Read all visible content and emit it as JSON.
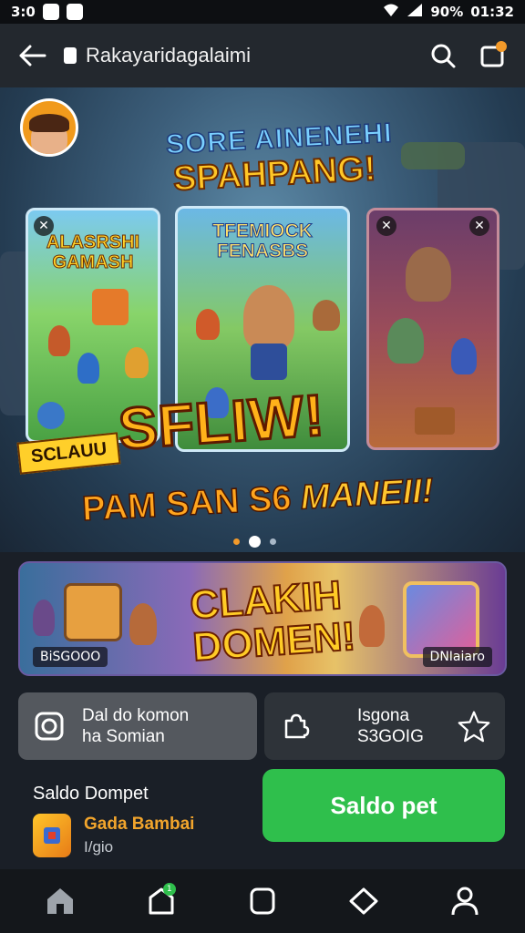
{
  "status_bar": {
    "time_left": "3:0",
    "battery": "90%",
    "clock": "01:32"
  },
  "browser": {
    "url": "Rakayaridagalaimi"
  },
  "hero": {
    "title_line1": "SORE AINENEHI",
    "title_line2": "SPAHPANG!",
    "card_left_title": "ALASRSHI GAMASH",
    "card_center_title": "TFEMIOCK FENASBS",
    "headline": "SFLIW!",
    "ribbon": "SCLAUU",
    "subheadline_plain": "PAM SAN S6 ",
    "subheadline_emph": "MANEII!",
    "carousel_dots": 3,
    "active_dot": 1
  },
  "promo_banner": {
    "title_line1": "CLAKIH",
    "title_line2": "DOMEN!",
    "tag_left": "BiSGOOO",
    "tag_right": "DNIaiaro"
  },
  "tiles": [
    {
      "line1": "Dal do komon",
      "line2": "ha Somian",
      "icon": "target-icon"
    },
    {
      "line1": "Isgona",
      "line2": "S3GOIG",
      "icon": "puzzle-icon",
      "trailing_icon": "star-icon"
    }
  ],
  "wallet": {
    "section_title": "Saldo Dompet",
    "game_name": "Gada Bambai",
    "game_sub": "I/gio",
    "button_label": "Saldo  pet"
  },
  "nav": {
    "items": [
      "home",
      "shop",
      "square",
      "diamond",
      "profile"
    ],
    "shop_badge": "1"
  },
  "colors": {
    "accent_green": "#2fbf4c",
    "gold": "#ffc727",
    "bg": "#1a1f27"
  }
}
